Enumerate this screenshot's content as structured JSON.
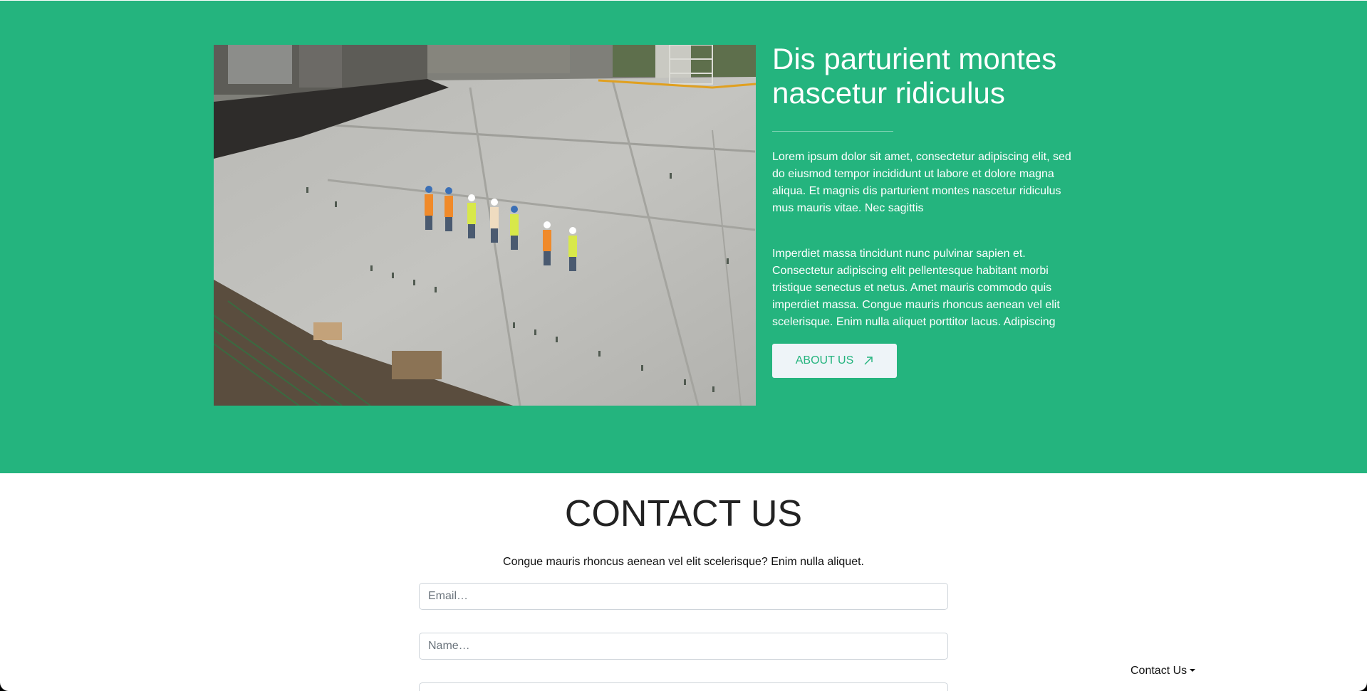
{
  "about": {
    "headline": "Dis parturient montes nascetur ridiculus",
    "paragraph_1": "Lorem ipsum dolor sit amet, consectetur adipiscing elit, sed do eiusmod tempor incididunt ut labore et dolore magna aliqua. Et magnis dis parturient montes nascetur ridiculus mus mauris vitae. Nec sagittis",
    "paragraph_2": "Imperdiet massa tincidunt nunc pulvinar sapien et. Consectetur adipiscing elit pellentesque habitant morbi tristique senectus et netus. Amet mauris commodo quis imperdiet massa. Congue mauris rhoncus aenean vel elit scelerisque. Enim nulla aliquet porttitor lacus. Adipiscing",
    "button_label": "ABOUT US",
    "button_icon": "arrow-up-right-icon",
    "image_icon": "construction-site-photo"
  },
  "contact": {
    "title": "CONTACT US",
    "subtitle": "Congue mauris rhoncus aenean vel elit scelerisque? Enim nulla aliquet.",
    "email_placeholder": "Email…",
    "name_placeholder": "Name…",
    "third_placeholder": ""
  },
  "nav": {
    "contact_dropdown_label": "Contact Us"
  },
  "colors": {
    "section_green": "#24b47e",
    "button_bg": "#eef4f8",
    "button_text": "#24b47e",
    "title_text": "#222222"
  }
}
